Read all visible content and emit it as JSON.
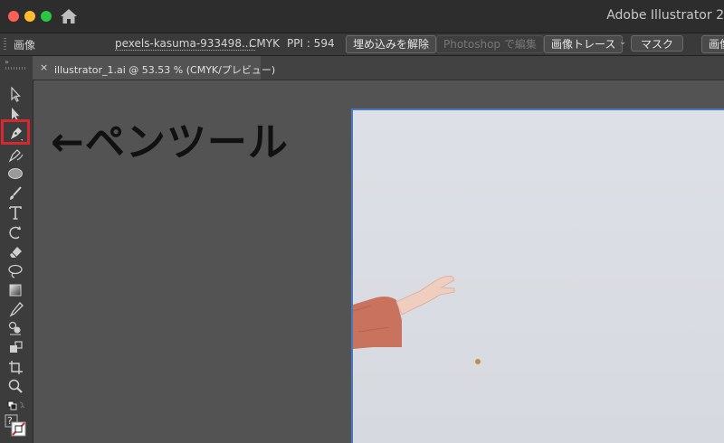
{
  "window": {
    "app_title": "Adobe Illustrator 2"
  },
  "control_bar": {
    "object_type": "画像",
    "file_name": "pexels-kasuma-933498....",
    "color_mode": "CMYK",
    "ppi": "PPI : 594",
    "embed_button": "埋め込みを解除",
    "photoshop_button": "Photoshop で編集",
    "image_trace_button": "画像トレース",
    "mask_button": "マスク",
    "crop_button": "画像"
  },
  "document": {
    "tab_label": "illustrator_1.ai @ 53.53 % (CMYK/プレビュー)",
    "tab_close": "×"
  },
  "annotation": {
    "text": "←ペンツール"
  },
  "toolbar": {
    "collapse": "»",
    "tools": [
      "selection-tool",
      "direct-selection-tool",
      "pen-tool",
      "curvature-tool",
      "ellipse-tool",
      "paintbrush-tool",
      "type-tool",
      "rotate-tool",
      "eraser-tool",
      "lasso-tool",
      "gradient-tool",
      "eyedropper-tool",
      "blend-tool",
      "live-paint-tool",
      "artboard-tool",
      "zoom-tool"
    ],
    "selected_tool": "pen-tool",
    "fill_stroke_help": "?"
  },
  "colors": {
    "highlight": "#d7282f",
    "artboard_border": "#4a78b8"
  }
}
